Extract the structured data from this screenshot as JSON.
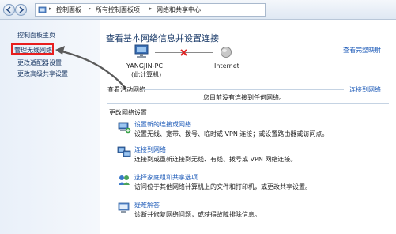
{
  "address_bar": {
    "crumbs": [
      "控制面板",
      "所有控制面板项",
      "网络和共享中心"
    ]
  },
  "sidebar": {
    "home": "控制面板主页",
    "items": [
      "管理无线网络",
      "更改适配器设置",
      "更改高级共享设置"
    ]
  },
  "main": {
    "title": "查看基本网络信息并设置连接",
    "full_map_link": "查看完整映射",
    "map": {
      "computer_name": "YANGJIN-PC",
      "computer_sub": "(此计算机)",
      "internet": "Internet"
    },
    "active_networks": {
      "label": "查看活动网络",
      "link": "连接到网络",
      "status": "您目前没有连接到任何网络。"
    },
    "change_settings_label": "更改网络设置",
    "tasks": [
      {
        "title": "设置新的连接或网络",
        "desc": "设置无线、宽带、拨号、临时或 VPN 连接；或设置路由器或访问点。"
      },
      {
        "title": "连接到网络",
        "desc": "连接到或重新连接到无线、有线、拨号或 VPN 网络连接。"
      },
      {
        "title": "选择家庭组和共享选项",
        "desc": "访问位于其他网络计算机上的文件和打印机，或更改共享设置。"
      },
      {
        "title": "疑难解答",
        "desc": "诊断并修复网络问题，或获得故障排除信息。"
      }
    ]
  },
  "colors": {
    "highlight": "#e81f1f",
    "link": "#1e5bb8",
    "title": "#1d3d6b"
  }
}
